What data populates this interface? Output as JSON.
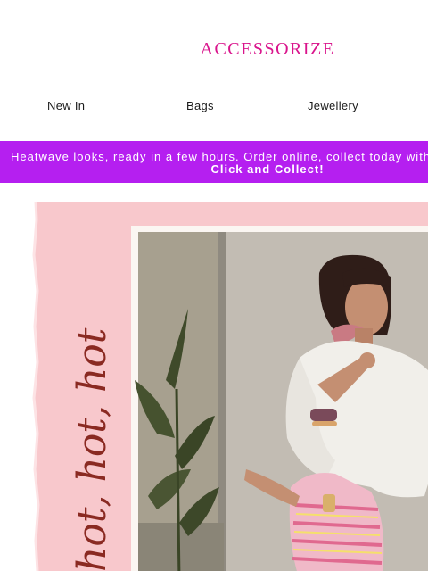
{
  "header": {
    "logo_text": "ACCESSORIZE"
  },
  "nav": {
    "items": [
      "New In",
      "Bags",
      "Jewellery"
    ]
  },
  "banner": {
    "message": "Heatwave looks, ready in a few hours. Order online, collect today with",
    "cta": "Click and Collect!",
    "background": "#b51ff0"
  },
  "hero": {
    "script_text": "hot, hot, hot",
    "colors": {
      "pink_paper": "#f8c8cc",
      "script": "#8a2a22"
    }
  },
  "colors": {
    "brand": "#d9148c"
  }
}
